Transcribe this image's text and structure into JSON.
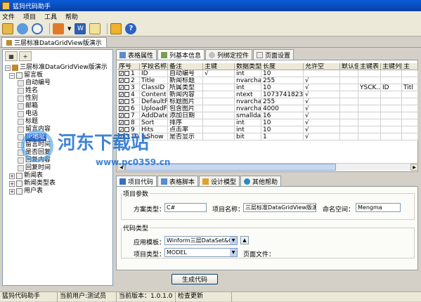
{
  "window": {
    "title": "猛犸代码助手"
  },
  "menu": [
    "文件",
    "项目",
    "工具",
    "帮助"
  ],
  "toolbar": {
    "icons": [
      "open-folder-icon",
      "users-icon",
      "search-icon",
      "export-icon",
      "chevron-down-icon",
      "word-icon",
      "document-icon",
      "copy-icon",
      "help-icon"
    ]
  },
  "doc_tab": "三层标准DataGridView版演示",
  "left": {
    "btn1": "▦",
    "btn2": "+",
    "tree": {
      "root": "三层标准DataGridView版演示",
      "table1": "留言板",
      "fields": [
        "自动编号",
        "姓名",
        "性别",
        "邮箱",
        "电话",
        "标题",
        "留言内容",
        "IP地址",
        "留言时间",
        "是否回复",
        "回复内容",
        "回复时间"
      ],
      "table2": "新闻表",
      "table3": "新闻类型表",
      "table4": "用户表"
    }
  },
  "tabs_top": [
    "表格属性",
    "列基本信息",
    "列绑定控件",
    "页面设置"
  ],
  "grid": {
    "headers": [
      "序号",
      "字段名称",
      "备注",
      "主键",
      "数据类型",
      "长度",
      "允许空",
      "默认值",
      "主键表",
      "主键列",
      "主"
    ],
    "rows": [
      [
        "1",
        "ID",
        "自动编号",
        "√",
        "int",
        "10",
        "",
        "",
        "",
        "",
        ""
      ],
      [
        "2",
        "Title",
        "新闻标题",
        "",
        "nvarchar",
        "255",
        "√",
        "",
        "",
        "",
        ""
      ],
      [
        "3",
        "ClassID",
        "所属类型",
        "",
        "int",
        "10",
        "√",
        "",
        "YSCK...",
        "ID",
        "Titl"
      ],
      [
        "4",
        "Content",
        "新闻内容",
        "",
        "ntext",
        "1073741823",
        "√",
        "",
        "",
        "",
        ""
      ],
      [
        "5",
        "DefaultPicUrl",
        "标题图片",
        "",
        "nvarchar",
        "255",
        "√",
        "",
        "",
        "",
        ""
      ],
      [
        "6",
        "UploadFiles",
        "包含图片",
        "",
        "nvarchar",
        "4000",
        "√",
        "",
        "",
        "",
        ""
      ],
      [
        "7",
        "AddDate",
        "添加日期",
        "",
        "smalldatetime",
        "16",
        "√",
        "",
        "",
        "",
        ""
      ],
      [
        "8",
        "Sort",
        "排序",
        "",
        "int",
        "10",
        "√",
        "",
        "",
        "",
        ""
      ],
      [
        "9",
        "Hits",
        "点击率",
        "",
        "int",
        "10",
        "√",
        "",
        "",
        "",
        ""
      ],
      [
        "10",
        "IsShow",
        "是否显示",
        "",
        "bit",
        "1",
        "√",
        "",
        "",
        "",
        ""
      ]
    ]
  },
  "tabs_bottom": [
    "项目代码",
    "表格脚本",
    "设计模型",
    "其他帮助"
  ],
  "project_params": {
    "legend": "项目参数",
    "scheme_label": "方案类型：",
    "scheme_value": "C#",
    "name_label": "项目名称：",
    "name_value": "三层标准DataGridView版演示",
    "ns_label": "命名空间：",
    "ns_value": "Mengma"
  },
  "code_type": {
    "legend": "代码类型",
    "template_label": "应用模板：",
    "template_value": "Winform三层DataSet&GridView",
    "projtype_label": "项目类型：",
    "projtype_value": "MODEL",
    "pagefile_label": "页面文件："
  },
  "generate_button": "生成代码",
  "status": [
    "猛犸代码助手",
    "当前用户:测试员",
    "当前版本：1.0.1.0",
    "检查更新"
  ],
  "watermark": {
    "text": "河东下载站",
    "url": "www.pc0359.cn"
  }
}
